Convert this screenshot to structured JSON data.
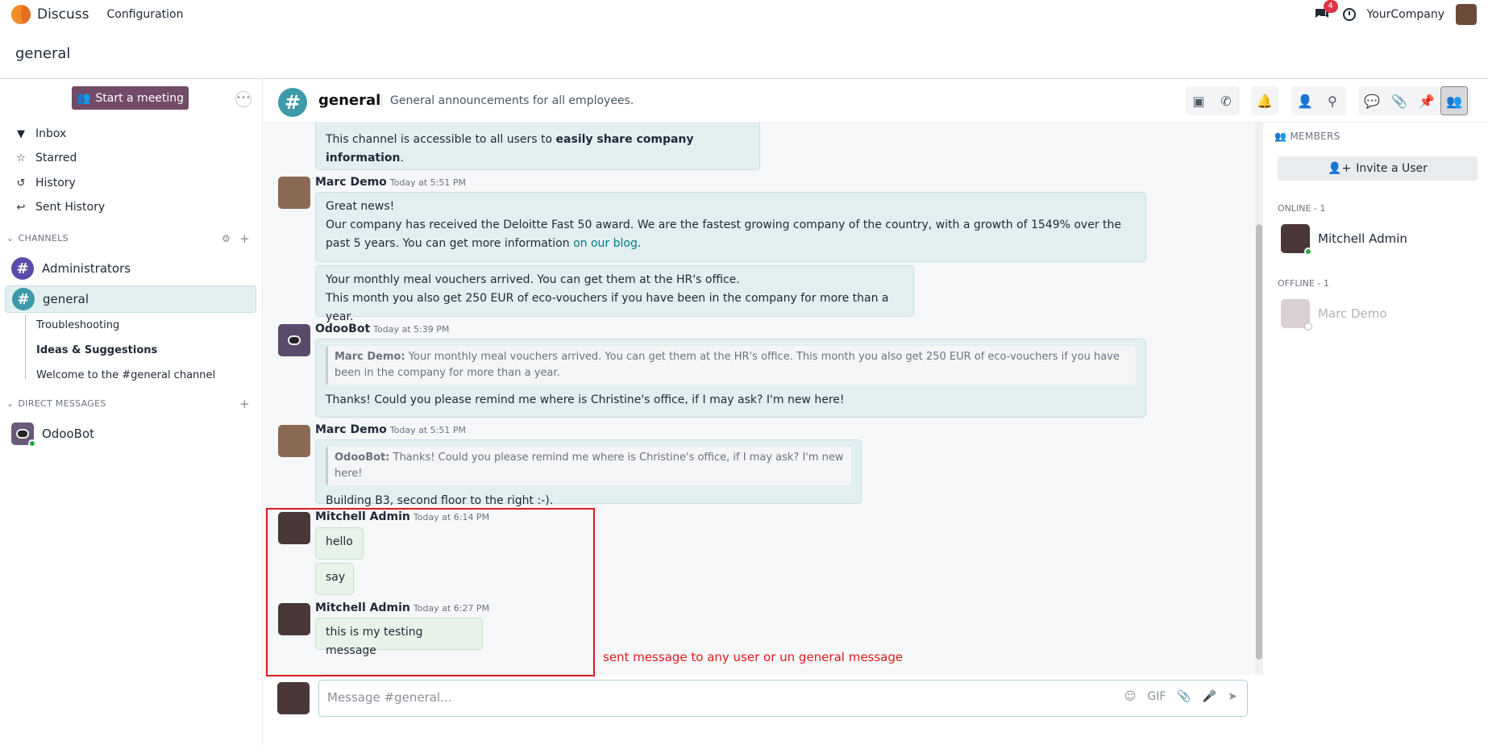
{
  "topbar": {
    "app_name": "Discuss",
    "menu": "Configuration",
    "notif_count": "4",
    "company": "YourCompany"
  },
  "breadcrumb": {
    "title": "general"
  },
  "sidebar": {
    "meeting_btn": "Start a meeting",
    "nav": [
      "Inbox",
      "Starred",
      "History",
      "Sent History"
    ],
    "channels_head": "CHANNELS",
    "channels": [
      "Administrators",
      "general"
    ],
    "threads": [
      "Troubleshooting",
      "Ideas & Suggestions",
      "Welcome to the #general channel"
    ],
    "dm_head": "DIRECT MESSAGES",
    "dms": [
      "OdooBot"
    ]
  },
  "header": {
    "name": "general",
    "description": "General announcements for all employees."
  },
  "messages": {
    "m0_text_a": "This channel is accessible to all users to ",
    "m0_text_b": "easily share company information",
    "m0_text_c": ".",
    "m1_author": "Marc Demo",
    "m1_time": "Today at 5:51 PM",
    "m1_line1": "Great news!",
    "m1_line2a": "Our company has received the Deloitte Fast 50 award. We are the fastest growing company of the country, with a growth of 1549% over the past 5 years. You can get more information ",
    "m1_link": "on our blog",
    "m1_line2c": ".",
    "m1b_line1": "Your monthly meal vouchers arrived. You can get them at the HR's office.",
    "m1b_line2": "This month you also get 250 EUR of eco-vouchers if you have been in the company for more than a year.",
    "m2_author": "OdooBot",
    "m2_time": "Today at 5:39 PM",
    "m2_quote_author": "Marc Demo:",
    "m2_quote": "Your monthly meal vouchers arrived. You can get them at the HR's office. This month you also get 250 EUR of eco-vouchers if you have been in the company for more than a year.",
    "m2_text": "Thanks! Could you please remind me where is Christine's office, if I may ask? I'm new here!",
    "m3_author": "Marc Demo",
    "m3_time": "Today at 5:51 PM",
    "m3_quote_author": "OdooBot:",
    "m3_quote": "Thanks! Could you please remind me where is Christine's office, if I may ask? I'm new here!",
    "m3_text": "Building B3, second floor to the right :-).",
    "m4_author": "Mitchell Admin",
    "m4_time": "Today at 6:14 PM",
    "m4_text": "hello",
    "m4b_text": "say",
    "m5_author": "Mitchell Admin",
    "m5_time": "Today at 6:27 PM",
    "m5_text": "this is my testing message"
  },
  "annotation": "sent message to any user or un general message",
  "composer": {
    "placeholder": "Message #general...",
    "gif": "GIF"
  },
  "members": {
    "head": "MEMBERS",
    "invite": "Invite a User",
    "online_head": "ONLINE - 1",
    "online": [
      "Mitchell Admin"
    ],
    "offline_head": "OFFLINE - 1",
    "offline": [
      "Marc Demo"
    ]
  }
}
